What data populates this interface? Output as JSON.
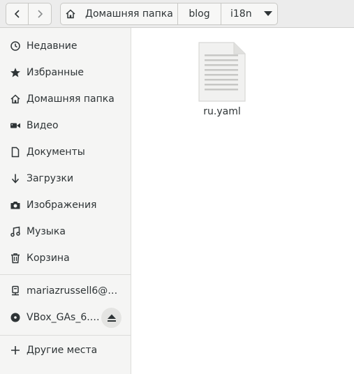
{
  "nav": {
    "back_icon": "chevron-left-icon",
    "forward_icon": "chevron-right-icon"
  },
  "path": {
    "home_icon": "home-icon",
    "crumbs": [
      "Домашняя папка",
      "blog",
      "i18n"
    ],
    "menu_icon": "triangle-down-icon"
  },
  "sidebar": {
    "items": [
      {
        "label": "Недавние",
        "icon": "clock-icon"
      },
      {
        "label": "Избранные",
        "icon": "star-icon"
      },
      {
        "label": "Домашняя папка",
        "icon": "home-icon"
      },
      {
        "label": "Видео",
        "icon": "video-icon"
      },
      {
        "label": "Документы",
        "icon": "document-icon"
      },
      {
        "label": "Загрузки",
        "icon": "download-icon"
      },
      {
        "label": "Изображения",
        "icon": "camera-icon"
      },
      {
        "label": "Музыка",
        "icon": "music-icon"
      },
      {
        "label": "Корзина",
        "icon": "trash-icon"
      }
    ],
    "devices": [
      {
        "label": "mariazrussell6@…",
        "icon": "network-drive-icon"
      },
      {
        "label": "VBox_GAs_6.…",
        "icon": "disc-icon",
        "action_icon": "eject-icon"
      }
    ],
    "other": {
      "label": "Другие места",
      "icon": "plus-icon"
    }
  },
  "files": [
    {
      "name": "ru.yaml",
      "icon": "text-file-icon"
    }
  ]
}
